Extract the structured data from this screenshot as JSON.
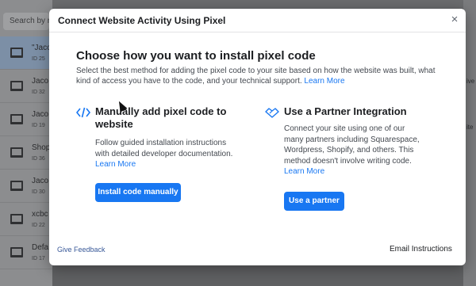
{
  "background": {
    "search_placeholder": "Search by n",
    "items": [
      {
        "name": "\"Jaco",
        "id": "ID 25"
      },
      {
        "name": "Jaco",
        "id": "ID 32"
      },
      {
        "name": "Jaco",
        "id": "ID 19"
      },
      {
        "name": "Shop",
        "id": "ID 36"
      },
      {
        "name": "Jaco",
        "id": "ID 30"
      },
      {
        "name": "xcbc",
        "id": "ID 22"
      },
      {
        "name": "Defa",
        "id": "ID 17"
      }
    ],
    "right_fragments": [
      "ive",
      "ite"
    ]
  },
  "modal": {
    "title": "Connect Website Activity Using Pixel",
    "close_label": "×",
    "heading": "Choose how you want to install pixel code",
    "intro": "Select the best method for adding the pixel code to your site based on how the website was built, what kind of access you have to the code, and your technical support.",
    "intro_link": "Learn More",
    "manual": {
      "icon": "code-icon",
      "title": "Manually add pixel code to website",
      "text": "Follow guided installation instructions with detailed developer documentation.",
      "link": "Learn More",
      "button": "Install code manually"
    },
    "partner": {
      "icon": "handshake-icon",
      "title": "Use a Partner Integration",
      "text": "Connect your site using one of our many partners including Squarespace, Wordpress, Shopify, and others. This method doesn't involve writing code.",
      "link": "Learn More",
      "button": "Use a partner"
    },
    "feedback": "Give Feedback",
    "email": "Email Instructions"
  },
  "colors": {
    "accent": "#1877f2",
    "text": "#1c1e21",
    "overlay": "#5f6062"
  }
}
